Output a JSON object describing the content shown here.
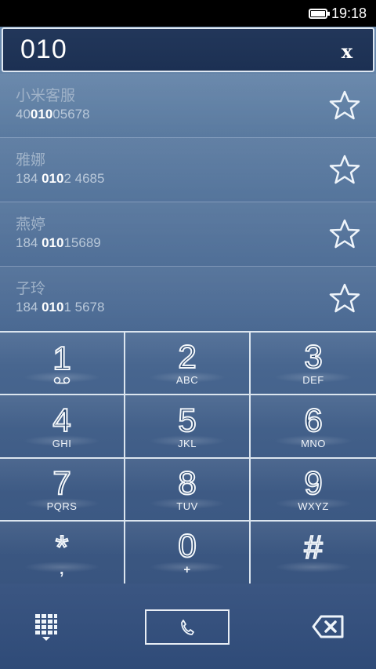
{
  "status": {
    "time": "19:18"
  },
  "input": {
    "value": "010",
    "clear_label": "x"
  },
  "contacts": [
    {
      "name": "小米客服",
      "phone_pre": "40",
      "phone_match": "010",
      "phone_post": "05678"
    },
    {
      "name": "雅娜",
      "phone_pre": "184 ",
      "phone_match": "010",
      "phone_post": "2 4685"
    },
    {
      "name": "燕婷",
      "phone_pre": "184 ",
      "phone_match": "010",
      "phone_post": "15689"
    },
    {
      "name": "子玲",
      "phone_pre": "184 ",
      "phone_match": "010",
      "phone_post": "1 5678"
    }
  ],
  "keys": [
    {
      "digit": "1",
      "letters": ""
    },
    {
      "digit": "2",
      "letters": "ABC"
    },
    {
      "digit": "3",
      "letters": "DEF"
    },
    {
      "digit": "4",
      "letters": "GHI"
    },
    {
      "digit": "5",
      "letters": "JKL"
    },
    {
      "digit": "6",
      "letters": "MNO"
    },
    {
      "digit": "7",
      "letters": "PQRS"
    },
    {
      "digit": "8",
      "letters": "TUV"
    },
    {
      "digit": "9",
      "letters": "WXYZ"
    },
    {
      "digit": "*",
      "letters": ","
    },
    {
      "digit": "0",
      "letters": "+"
    },
    {
      "digit": "#",
      "letters": ""
    }
  ],
  "icons": {
    "battery": "battery-icon",
    "star": "star-icon",
    "voicemail": "voicemail-icon",
    "dialpad": "dialpad-icon",
    "call": "phone-icon",
    "backspace": "backspace-icon"
  },
  "colors": {
    "accent": "#ffffff",
    "background": "#4d6c95",
    "field": "#1c3053"
  }
}
